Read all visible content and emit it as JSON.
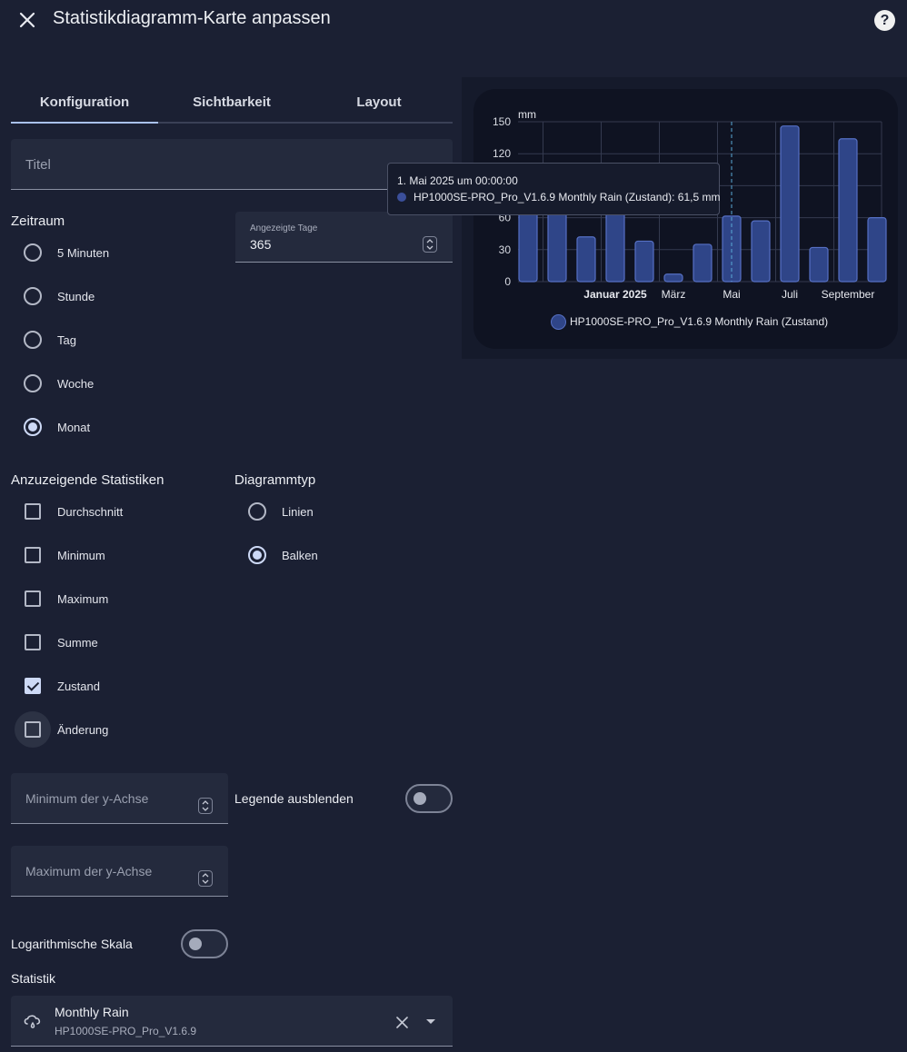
{
  "header": {
    "title": "Statistikdiagramm-Karte anpassen",
    "help": "?"
  },
  "tabs": [
    {
      "label": "Konfiguration",
      "active": true
    },
    {
      "label": "Sichtbarkeit",
      "active": false
    },
    {
      "label": "Layout",
      "active": false
    }
  ],
  "title_field": {
    "placeholder": "Titel"
  },
  "period": {
    "label": "Zeitraum",
    "options": [
      {
        "label": "5 Minuten",
        "checked": false
      },
      {
        "label": "Stunde",
        "checked": false
      },
      {
        "label": "Tag",
        "checked": false
      },
      {
        "label": "Woche",
        "checked": false
      },
      {
        "label": "Monat",
        "checked": true
      }
    ]
  },
  "days_field": {
    "label": "Angezeigte Tage",
    "value": "365"
  },
  "stat_types": {
    "label": "Anzuzeigende Statistiken",
    "options": [
      {
        "label": "Durchschnitt",
        "checked": false
      },
      {
        "label": "Minimum",
        "checked": false
      },
      {
        "label": "Maximum",
        "checked": false
      },
      {
        "label": "Summe",
        "checked": false
      },
      {
        "label": "Zustand",
        "checked": true
      },
      {
        "label": "Änderung",
        "checked": false
      }
    ]
  },
  "chart_type": {
    "label": "Diagrammtyp",
    "options": [
      {
        "label": "Linien",
        "checked": false
      },
      {
        "label": "Balken",
        "checked": true
      }
    ]
  },
  "ymin_field": {
    "placeholder": "Minimum der y-Achse"
  },
  "ymax_field": {
    "placeholder": "Maximum der y-Achse"
  },
  "hide_legend": {
    "label": "Legende ausblenden",
    "on": false
  },
  "log_scale": {
    "label": "Logarithmische Skala",
    "on": false
  },
  "statistic": {
    "label": "Statistik",
    "entity_name": "Monthly Rain",
    "entity_id": "HP1000SE-PRO_Pro_V1.6.9"
  },
  "chart_data": {
    "type": "bar",
    "ylabel": "mm",
    "ylim": [
      0,
      150
    ],
    "yticks": [
      0,
      30,
      60,
      120,
      150
    ],
    "xticks": [
      "Januar 2025",
      "März",
      "Mai",
      "Juli",
      "September"
    ],
    "series": [
      {
        "name": "HP1000SE-PRO_Pro_V1.6.9 Monthly Rain (Zustand)",
        "values": [
          68,
          75,
          42,
          70,
          38,
          7,
          35,
          61.5,
          57,
          146,
          32,
          134,
          60
        ]
      }
    ],
    "tooltip": {
      "title": "1. Mai 2025 um 00:00:00",
      "text": "HP1000SE-PRO_Pro_V1.6.9 Monthly Rain (Zustand): 61,5 mm"
    },
    "legend": "HP1000SE-PRO_Pro_V1.6.9 Monthly Rain (Zustand)",
    "colors": {
      "bar": "#2f4588",
      "bar_border": "#5670c4",
      "crosshair": "#5aa9d6"
    }
  }
}
